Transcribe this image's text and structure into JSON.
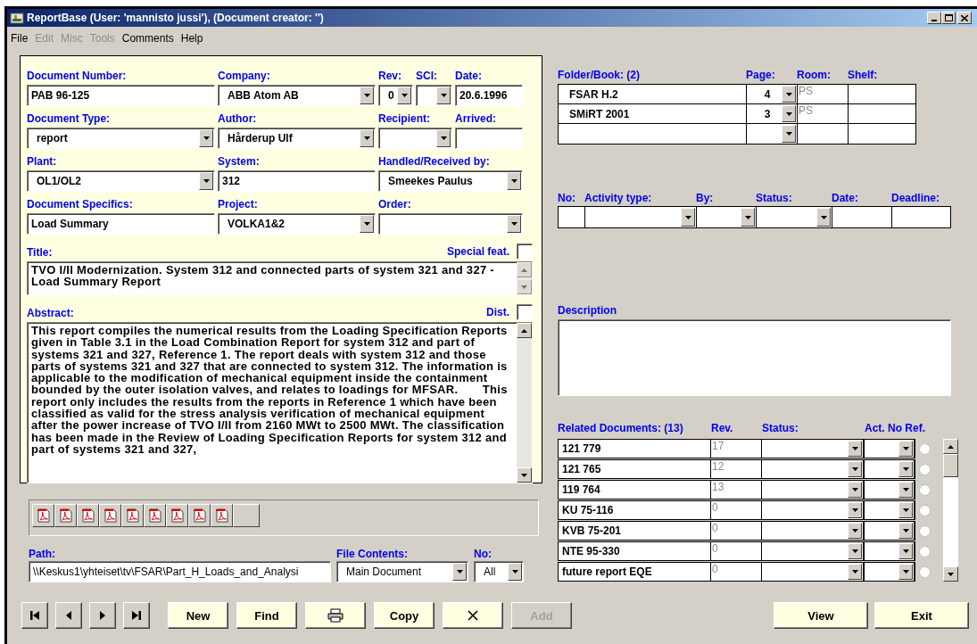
{
  "window": {
    "title": "ReportBase (User: 'mannisto jussi'), (Document creator: '')"
  },
  "menu": [
    {
      "label": "File",
      "disabled": false
    },
    {
      "label": "Edit",
      "disabled": true
    },
    {
      "label": "Misc",
      "disabled": true
    },
    {
      "label": "Tools",
      "disabled": true
    },
    {
      "label": "Comments",
      "disabled": false
    },
    {
      "label": "Help",
      "disabled": false
    }
  ],
  "form_rows": [
    {
      "fields": [
        {
          "label": "Document Number:",
          "kind": "text",
          "value": "PAB 96-125"
        },
        {
          "label": "Company:",
          "kind": "combo",
          "value": "ABB Atom AB"
        },
        {
          "label": "Rev:",
          "kind": "combo",
          "value": "0"
        },
        {
          "label": "SCI:",
          "kind": "combo"
        },
        {
          "label": "Date:",
          "kind": "text",
          "value": "20.6.1996"
        }
      ]
    },
    {
      "fields": [
        {
          "label": "Document Type:",
          "kind": "combo",
          "value": "report"
        },
        {
          "label": "Author:",
          "kind": "combo",
          "value": "Hårderup Ulf"
        },
        {
          "label": "Recipient:",
          "kind": "combo"
        },
        {
          "label": "Arrived:",
          "kind": "text"
        }
      ]
    },
    {
      "fields": [
        {
          "label": "Plant:",
          "kind": "combo",
          "value": "OL1/OL2"
        },
        {
          "label": "System:",
          "kind": "text",
          "value": "312"
        },
        {
          "label": "Handled/Received by:",
          "kind": "combo",
          "value": "Smeekes Paulus"
        }
      ]
    },
    {
      "fields": [
        {
          "label": "Document Specifics:",
          "kind": "text",
          "value": "Load Summary"
        },
        {
          "label": "Project:",
          "kind": "combo",
          "value": "VOLKA1&2"
        },
        {
          "label": "Order:",
          "kind": "combo"
        }
      ]
    }
  ],
  "title": {
    "label": "Title:",
    "value": "TVO I/II Modernization. System 312 and connected parts of system 321 and 327 - Load Summary Report",
    "flag_label": "Special feat.",
    "checked": false
  },
  "abstract": {
    "label": "Abstract:",
    "value": "This report compiles the numerical results from the Loading Specification Reports given in Table 3.1 in the Load Combination Report for system 312 and part of systems 321 and 327, Reference 1. The report deals with system 312 and those parts of systems 321 and 327 that are connected to system 312. The information is applicable to the modification of mechanical equipment inside the containment bounded by the outer isolation valves, and relates to loadings for MFSAR.       This report only includes the results from the reports in Reference 1 which have been classified as valid for the stress analysis verification of mechanical equipment after the power increase of TVO I/II from 2160 MWt to 2500 MWt. The classification has been made in the Review of Loading Specification Reports for system 312 and part of systems 321 and 327,",
    "flag_label": "Dist.",
    "checked": false
  },
  "attachments": [
    {
      "kind": "pdf"
    },
    {
      "kind": "pdf"
    },
    {
      "kind": "pdf"
    },
    {
      "kind": "pdf"
    },
    {
      "kind": "pdf"
    },
    {
      "kind": "pdf"
    },
    {
      "kind": "pdf"
    },
    {
      "kind": "pdf"
    },
    {
      "kind": "pdf"
    },
    {
      "kind": "empty"
    }
  ],
  "path": {
    "label": "Path:",
    "value": "\\\\Keskus1\\yhteiset\\tv\\FSAR\\Part_H_Loads_and_Analysi"
  },
  "file_contents": {
    "label": "File Contents:",
    "value": "Main Document"
  },
  "file_no": {
    "label": "No:",
    "value": "All"
  },
  "folders": {
    "columns": [
      "Folder/Book: (2)",
      "Page:",
      "Room:",
      "Shelf:"
    ],
    "rows": [
      {
        "name": "FSAR  H.2",
        "page": "4",
        "room": "PS"
      },
      {
        "name": "SMiRT 2001",
        "page": "3",
        "room": "PS"
      },
      {}
    ]
  },
  "activities": {
    "columns": [
      "No:",
      "Activity type:",
      "By:",
      "Status:",
      "Date:",
      "Deadline:"
    ],
    "rows": [
      {}
    ]
  },
  "description": {
    "label": "Description"
  },
  "related": {
    "columns": [
      "Related Documents: (13)",
      "Rev.",
      "Status:",
      "Act. No Ref."
    ],
    "rows": [
      {
        "name": "121 779",
        "rev": "17",
        "ref": false
      },
      {
        "name": "121 765",
        "rev": "12",
        "ref": false
      },
      {
        "name": "119 764",
        "rev": "13",
        "ref": false
      },
      {
        "name": "KU 75-116",
        "rev": "0",
        "ref": false
      },
      {
        "name": "KVB 75-201",
        "rev": "0",
        "ref": false
      },
      {
        "name": "NTE 95-330",
        "rev": "0",
        "ref": false
      },
      {
        "name": "future report EQE",
        "rev": "0",
        "ref": false
      }
    ]
  },
  "toolbar_buttons": [
    {
      "kind": "first",
      "disabled": false
    },
    {
      "kind": "prev",
      "disabled": false
    },
    {
      "kind": "next",
      "disabled": false
    },
    {
      "kind": "last",
      "disabled": false
    },
    {
      "kind": "text",
      "label": "New",
      "disabled": false
    },
    {
      "kind": "text",
      "label": "Find",
      "disabled": false
    },
    {
      "kind": "print",
      "disabled": false
    },
    {
      "kind": "text",
      "label": "Copy",
      "disabled": false
    },
    {
      "kind": "delete",
      "disabled": false
    },
    {
      "kind": "text",
      "label": "Add",
      "disabled": true
    }
  ],
  "dialog_buttons": [
    {
      "label": "View"
    },
    {
      "label": "Exit"
    }
  ]
}
